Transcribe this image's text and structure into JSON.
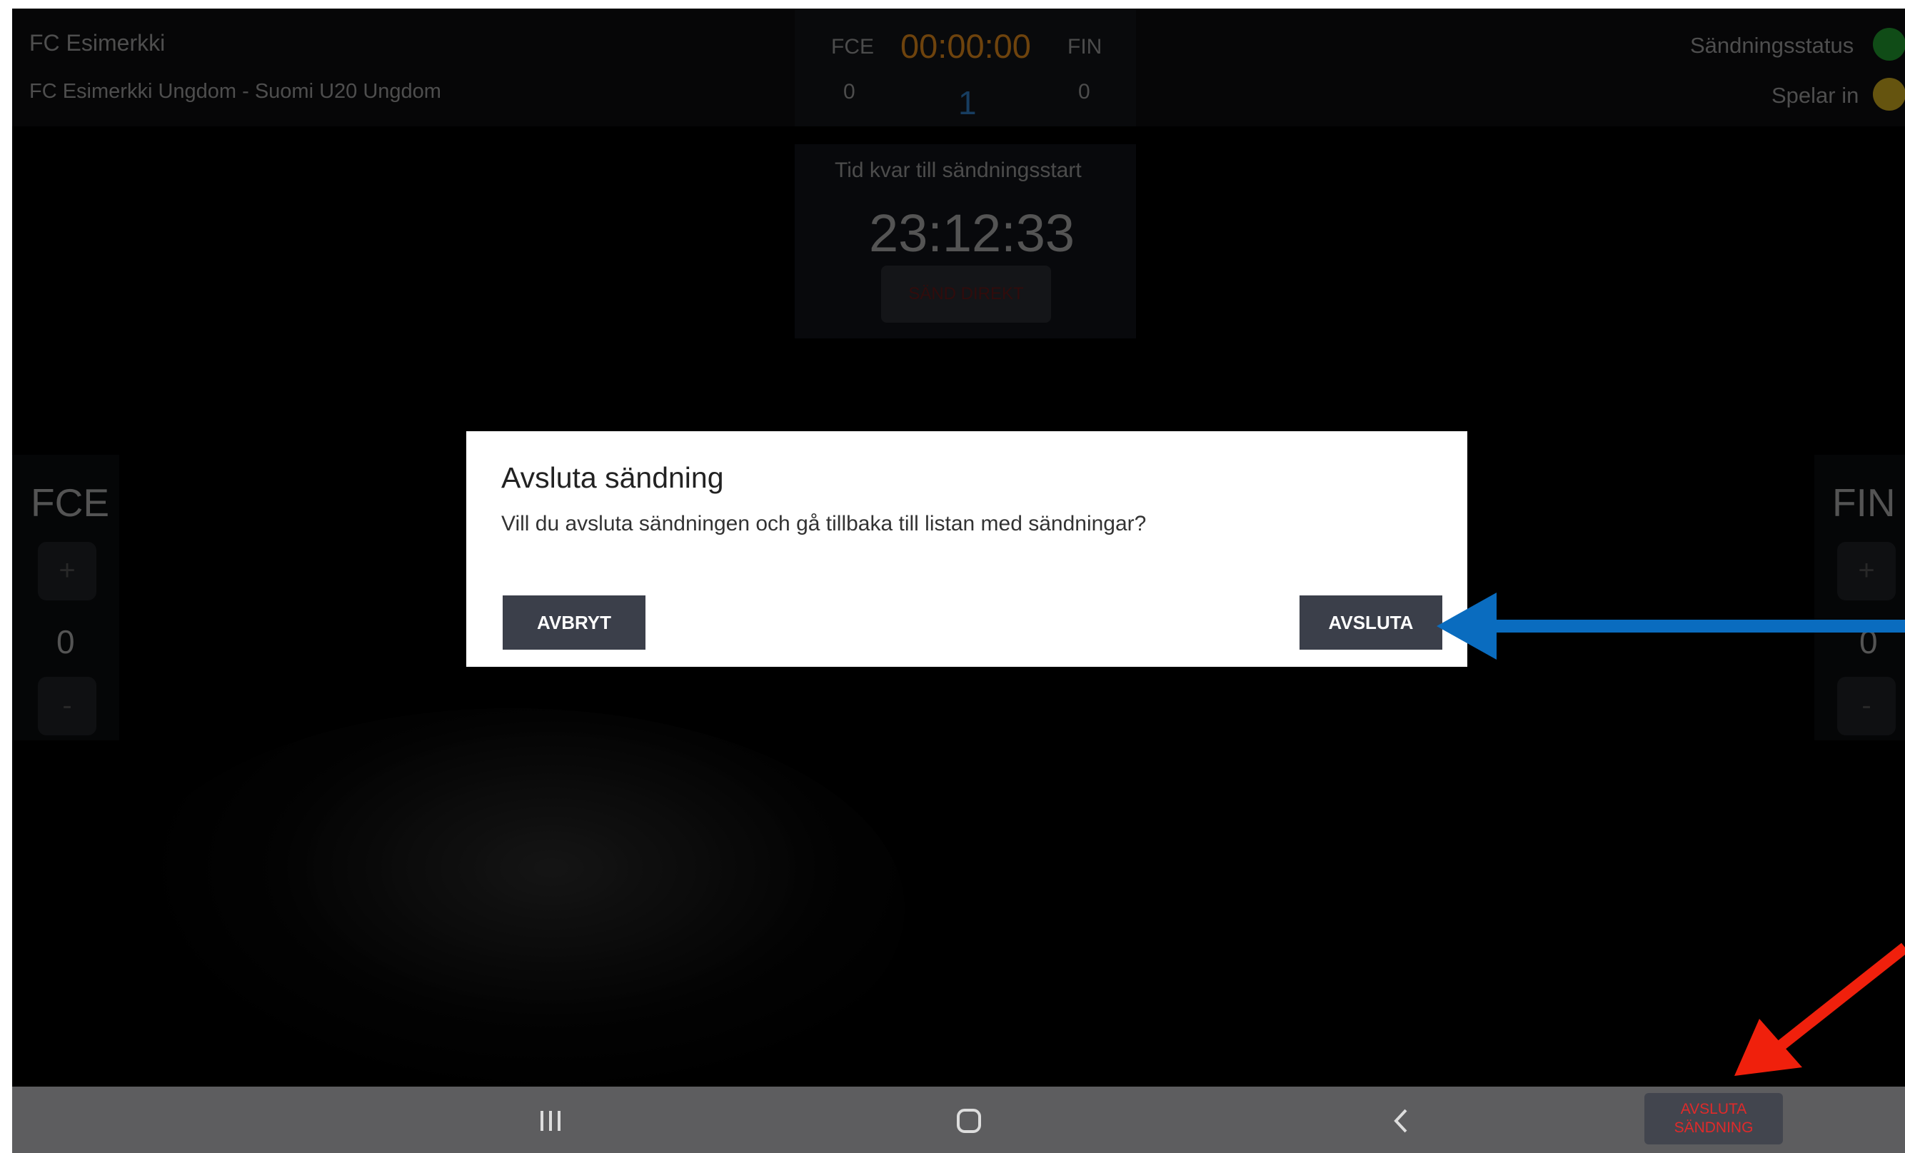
{
  "header": {
    "club_name": "FC Esimerkki",
    "match_title": "FC Esimerkki Ungdom - Suomi U20 Ungdom",
    "home_abbr": "FCE",
    "away_abbr": "FIN",
    "clock": "00:00:00",
    "home_score": "0",
    "away_score": "0",
    "period": "1",
    "broadcast_status_label": "Sändningsstatus",
    "recording_label": "Spelar in"
  },
  "countdown": {
    "label": "Tid kvar till sändningsstart",
    "time": "23:12:33",
    "send_now_label": "SÄND DIREKT"
  },
  "left_panel": {
    "team": "FCE",
    "plus": "+",
    "score": "0",
    "minus": "-"
  },
  "right_panel": {
    "team": "FIN",
    "plus": "+",
    "score": "0",
    "minus": "-"
  },
  "dialog": {
    "title": "Avsluta sändning",
    "message": "Vill du avsluta sändningen och gå tillbaka till listan med sändningar?",
    "cancel_label": "AVBRYT",
    "confirm_label": "AVSLUTA"
  },
  "bottom": {
    "end_broadcast_line1": "AVSLUTA",
    "end_broadcast_line2": "SÄNDNING"
  },
  "icons": {
    "recents": "recents-icon",
    "home": "home-icon",
    "back": "back-icon"
  },
  "colors": {
    "clock": "#c97a18",
    "status_green": "#1e8a2a",
    "status_yellow": "#b89a1c",
    "period_blue": "#2a6fb0",
    "blue_arrow": "#0a6cbf",
    "red_arrow": "#f0200c",
    "end_text": "#e02a2a"
  }
}
